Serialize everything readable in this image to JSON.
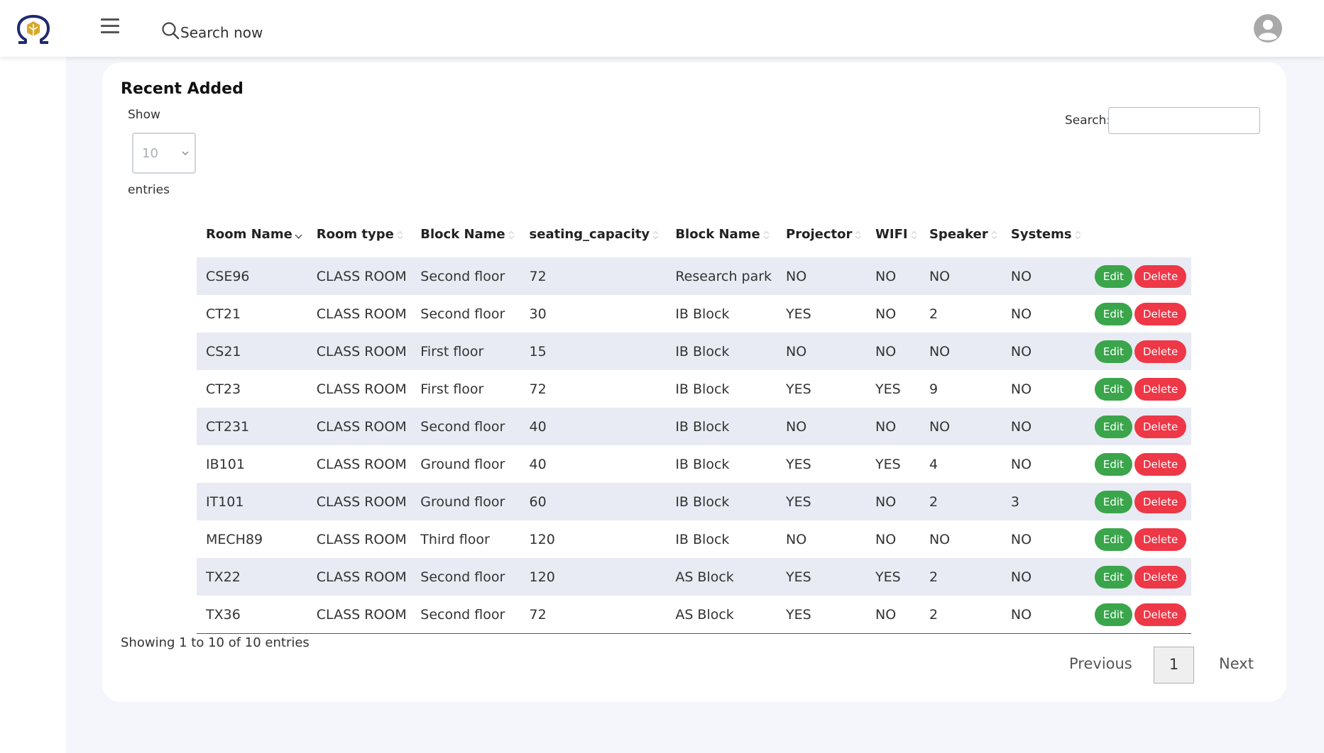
{
  "header": {
    "search_placeholder": "Search now",
    "icons": {
      "logo": "omega-logo",
      "menu": "hamburger-icon",
      "search": "search-icon",
      "avatar": "user-avatar-icon"
    }
  },
  "card": {
    "title": "Recent Added",
    "show_label": "Show",
    "entries_per_page": "10",
    "entries_label": "entries",
    "search_label": "Search:",
    "search_value": ""
  },
  "table": {
    "columns": [
      "Room Name",
      "Room type",
      "Block Name",
      "seating_capacity",
      "Block Name",
      "Projector",
      "WIFI",
      "Speaker",
      "Systems"
    ],
    "edit_label": "Edit",
    "delete_label": "Delete",
    "rows": [
      [
        "CSE96",
        "CLASS ROOM",
        "Second floor",
        "72",
        "Research park",
        "NO",
        "NO",
        "NO",
        "NO"
      ],
      [
        "CT21",
        "CLASS ROOM",
        "Second floor",
        "30",
        "IB Block",
        "YES",
        "NO",
        "2",
        "NO"
      ],
      [
        "CS21",
        "CLASS ROOM",
        "First floor",
        "15",
        "IB Block",
        "NO",
        "NO",
        "NO",
        "NO"
      ],
      [
        "CT23",
        "CLASS ROOM",
        "First floor",
        "72",
        "IB Block",
        "YES",
        "YES",
        "9",
        "NO"
      ],
      [
        "CT231",
        "CLASS ROOM",
        "Second floor",
        "40",
        "IB Block",
        "NO",
        "NO",
        "NO",
        "NO"
      ],
      [
        "IB101",
        "CLASS ROOM",
        "Ground floor",
        "40",
        "IB Block",
        "YES",
        "YES",
        "4",
        "NO"
      ],
      [
        "IT101",
        "CLASS ROOM",
        "Ground floor",
        "60",
        "IB Block",
        "YES",
        "NO",
        "2",
        "3"
      ],
      [
        "MECH89",
        "CLASS ROOM",
        "Third floor",
        "120",
        "IB Block",
        "NO",
        "NO",
        "NO",
        "NO"
      ],
      [
        "TX22",
        "CLASS ROOM",
        "Second floor",
        "120",
        "AS Block",
        "YES",
        "YES",
        "2",
        "NO"
      ],
      [
        "TX36",
        "CLASS ROOM",
        "Second floor",
        "72",
        "AS Block",
        "YES",
        "NO",
        "2",
        "NO"
      ]
    ]
  },
  "footer": {
    "info": "Showing 1 to 10 of 10 entries",
    "previous": "Previous",
    "current_page": "1",
    "next": "Next"
  },
  "colors": {
    "edit_button": "#3aa54b",
    "delete_button": "#ee3747",
    "striped_row": "#e8ebf3",
    "page_background": "#f4f6fc",
    "logo_blue": "#1f2a6e",
    "logo_gold": "#d9a72e"
  }
}
